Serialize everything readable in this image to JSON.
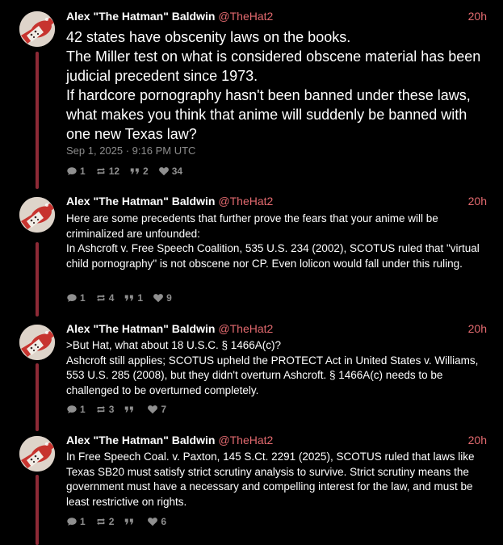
{
  "posts": [
    {
      "author": "Alex \"The Hatman\" Baldwin",
      "handle": "@TheHat2",
      "time": "20h",
      "text": "42 states have obscenity laws on the books.\nThe Miller test on what is considered obscene material has been judicial precedent since 1973.\nIf hardcore pornography hasn't been banned under these laws, what makes you think that anime will suddenly be banned with one new Texas law?",
      "date": "Sep 1, 2025 · 9:16 PM UTC",
      "replies": "1",
      "reposts": "12",
      "quotes": "2",
      "likes": "34"
    },
    {
      "author": "Alex \"The Hatman\" Baldwin",
      "handle": "@TheHat2",
      "time": "20h",
      "text": "Here are some precedents that further prove the fears that your anime will be criminalized are unfounded:\nIn Ashcroft v. Free Speech Coalition, 535 U.S. 234 (2002), SCOTUS ruled that \"virtual child pornography\" is not obscene nor CP. Even lolicon would fall under this ruling.",
      "replies": "1",
      "reposts": "4",
      "quotes": "1",
      "likes": "9"
    },
    {
      "author": "Alex \"The Hatman\" Baldwin",
      "handle": "@TheHat2",
      "time": "20h",
      "text": ">But Hat, what about 18 U.S.C. § 1466A(c)?\nAshcroft still applies; SCOTUS upheld the PROTECT Act in United States v. Williams, 553 U.S. 285 (2008), but they didn't overturn Ashcroft. § 1466A(c) needs to be challenged to be overturned completely.",
      "replies": "1",
      "reposts": "3",
      "quotes": "",
      "likes": "7"
    },
    {
      "author": "Alex \"The Hatman\" Baldwin",
      "handle": "@TheHat2",
      "time": "20h",
      "text": "In Free Speech Coal. v. Paxton, 145 S.Ct. 2291 (2025), SCOTUS ruled that laws like Texas SB20 must satisfy strict scrutiny analysis to survive. Strict scrutiny means the government must have a necessary and compelling interest for the law, and must be least restrictive on rights.",
      "replies": "1",
      "reposts": "2",
      "quotes": "",
      "likes": "6"
    }
  ],
  "icons": {
    "reply": "speech-bubble-icon",
    "repost": "repost-arrows-icon",
    "quote": "quote-marks-icon",
    "like": "heart-icon",
    "avatar": "red-hat-avatar"
  },
  "colors": {
    "background": "#000000",
    "text": "#ffffff",
    "accent": "#e36a6f",
    "muted": "#8b8b8b",
    "thread_line": "#8e2a36"
  }
}
